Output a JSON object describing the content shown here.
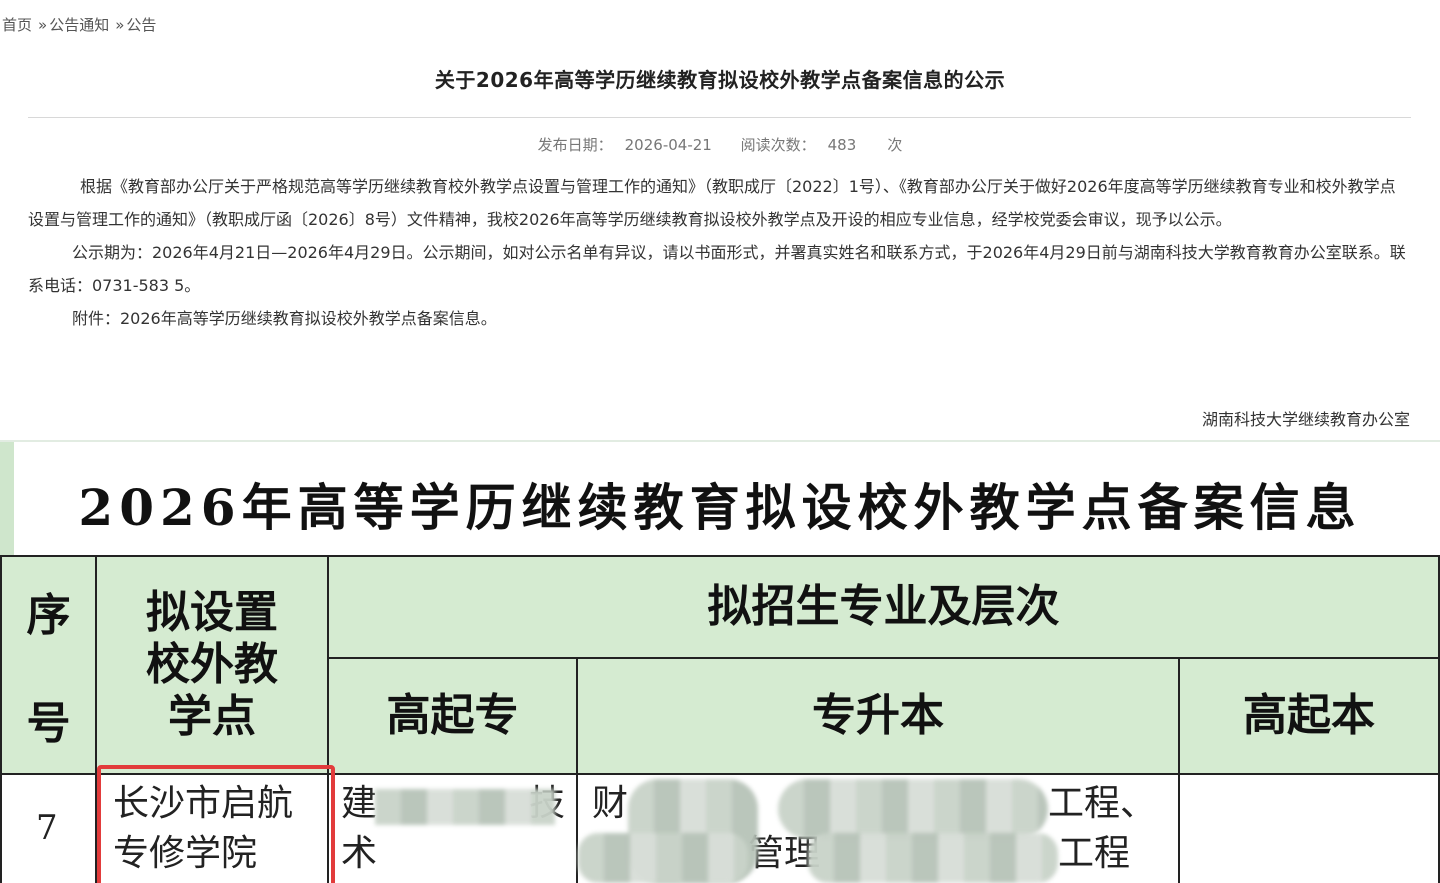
{
  "breadcrumb": {
    "home": "首页",
    "sep": "»",
    "level1": "公告通知",
    "level2": "公告"
  },
  "article": {
    "title": "关于2026年高等学历继续教育拟设校外教学点备案信息的公示",
    "date_label": "发布日期：",
    "date": "2026-04-21",
    "views_label": "阅读次数：",
    "views": "483",
    "views_unit": "次",
    "paragraphs": [
      "根据《教育部办公厅关于严格规范高等学历继续教育校外教学点设置与管理工作的通知》（教职成厅〔2022〕1号）、《教育部办公厅关于做好2026年度高等学历继续教育专业和校外教学点设置与管理工作的通知》（教职成厅函〔2026〕8号）文件精神，我校2026年高等学历继续教育拟设校外教学点及开设的相应专业信息，经学校党委会审议，现予以公示。",
      "公示期为：2026年4月21日—2026年4月29日。公示期间，如对公示名单有异议，请以书面形式，并署真实姓名和联系方式，于2026年4月29日前与湖南科技大学教育教育办公室联系。联系电话：0731-583  5。",
      "附件：2026年高等学历继续教育拟设校外教学点备案信息。"
    ],
    "signature": "湖南科技大学继续教育办公室"
  },
  "sheet": {
    "title": "2026年高等学历继续教育拟设校外教学点备案信息",
    "col_num_top": "序",
    "col_num_bottom": "号",
    "col_point": "拟设置校外教学点",
    "col_major_group": "拟招生专业及层次",
    "col_gqz": "高起专",
    "col_zsb": "专升本",
    "col_gqb": "高起本",
    "row": {
      "num": "7",
      "point": "长沙市启航专修学院",
      "gqz_a": "建",
      "gqz_b": "技",
      "gqz_c": "术",
      "zsb_a": "财",
      "zsb_b": "工程、",
      "zsb_c": "管理",
      "zsb_d": "工程"
    }
  },
  "colors": {
    "sheet_green": "#d5ebd1",
    "highlight_red": "#e23b3b"
  }
}
